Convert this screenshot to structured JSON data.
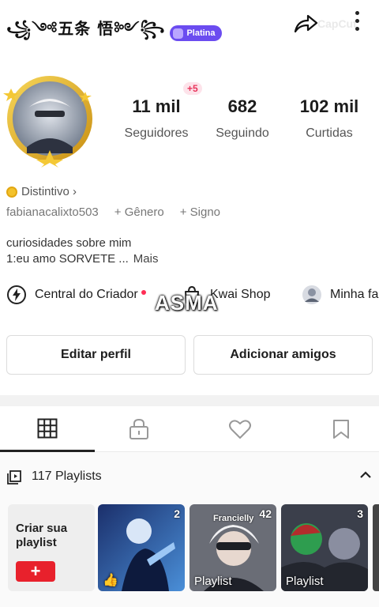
{
  "header": {
    "name": "꧁༺五条 悟༻꧂",
    "badge": "Platina",
    "watermark": "CapCut"
  },
  "stats": {
    "plus_badge": "+5",
    "followers_value": "11 mil",
    "followers_label": "Seguidores",
    "following_value": "682",
    "following_label": "Seguindo",
    "likes_value": "102 mil",
    "likes_label": "Curtidas"
  },
  "profile": {
    "distintivo": "Distintivo ›",
    "username": "fabianacalixto503",
    "genero": "+ Gênero",
    "signo": "+ Signo",
    "bio_line1": "curiosidades sobre mim",
    "bio_line2": "1:eu amo SORVETE ...",
    "bio_more": "Mais"
  },
  "links": {
    "creator": "Central do Criador",
    "shop": "Kwai Shop",
    "family": "Minha fa"
  },
  "overlay_text": "ASMA",
  "buttons": {
    "edit": "Editar perfil",
    "add": "Adicionar amigos"
  },
  "playlists": {
    "count_label": "117 Playlists",
    "create_label": "Criar sua playlist",
    "create_button": "+",
    "items": [
      {
        "count": "2",
        "label": ""
      },
      {
        "count": "42",
        "label": "Playlist",
        "caption": "Francielly"
      },
      {
        "count": "3",
        "label": "Playlist"
      }
    ]
  },
  "colors": {
    "accent_red": "#e8212c",
    "badge_purple": "#6b4cf0",
    "plus_pink": "#e8345b"
  }
}
